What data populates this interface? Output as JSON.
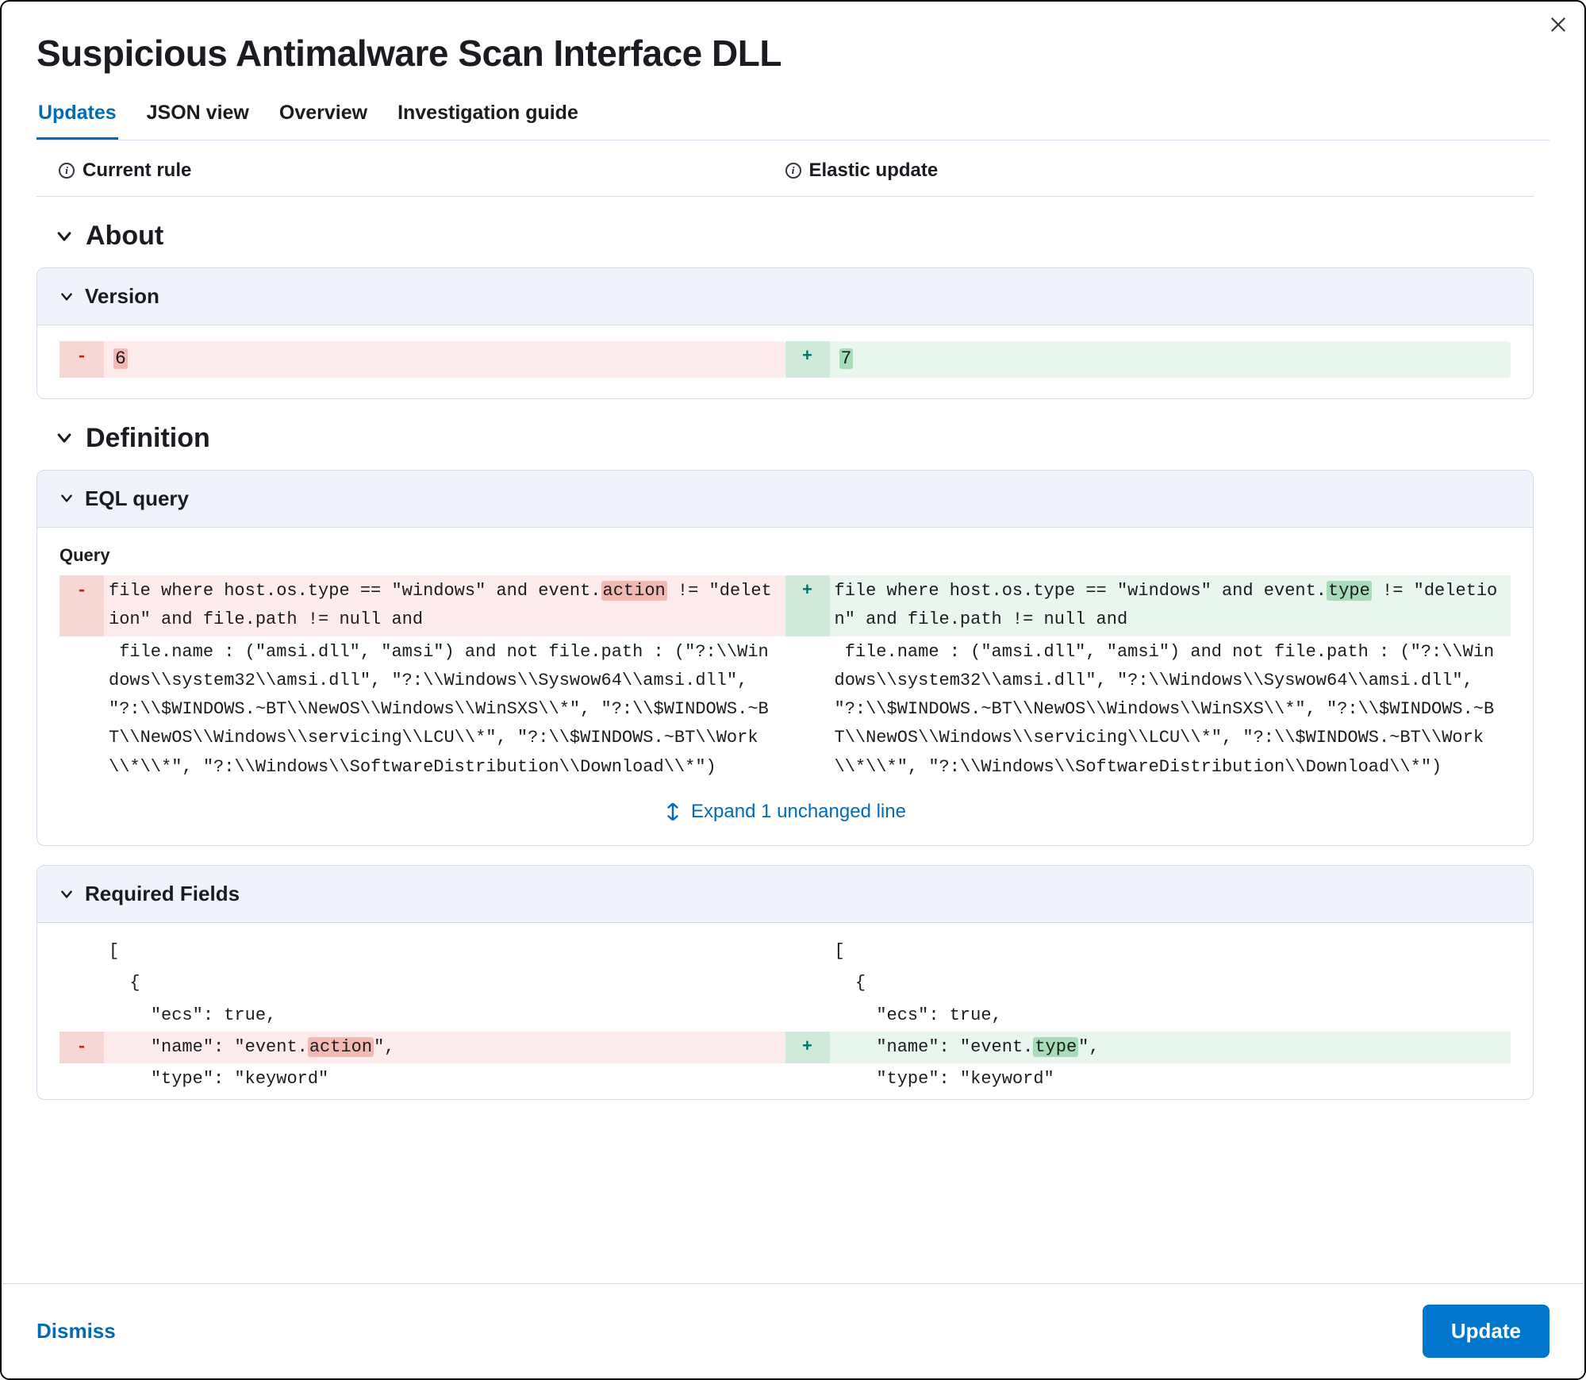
{
  "title": "Suspicious Antimalware Scan Interface DLL",
  "tabs": {
    "updates": "Updates",
    "json_view": "JSON view",
    "overview": "Overview",
    "investigation_guide": "Investigation guide"
  },
  "columns": {
    "current": "Current rule",
    "elastic": "Elastic update"
  },
  "sections": {
    "about": "About",
    "definition": "Definition"
  },
  "cards": {
    "version": "Version",
    "eql_query": "EQL query",
    "required_fields": "Required Fields"
  },
  "labels": {
    "query": "Query"
  },
  "version_diff": {
    "old": "6",
    "new": "7"
  },
  "query_diff": {
    "old_hl_pre": "file where host.os.type == \"windows\" and event.",
    "old_hl_token": "action",
    "old_hl_post": " != \"deletion\" and file.path != null and",
    "common": " file.name : (\"amsi.dll\", \"amsi\") and not file.path : (\"?:\\\\Windows\\\\system32\\\\amsi.dll\", \"?:\\\\Windows\\\\Syswow64\\\\amsi.dll\", \"?:\\\\$WINDOWS.~BT\\\\NewOS\\\\Windows\\\\WinSXS\\\\*\", \"?:\\\\$WINDOWS.~BT\\\\NewOS\\\\Windows\\\\servicing\\\\LCU\\\\*\", \"?:\\\\$WINDOWS.~BT\\\\Work\\\\*\\\\*\", \"?:\\\\Windows\\\\SoftwareDistribution\\\\Download\\\\*\")",
    "new_hl_pre": "file where host.os.type == \"windows\" and event.",
    "new_hl_token": "type",
    "new_hl_post": " != \"deletion\" and file.path != null and"
  },
  "expand_label": "Expand 1 unchanged line",
  "required_fields_diff": {
    "line1": "[",
    "line2": "  {",
    "line3": "    \"ecs\": true,",
    "old_name_pre": "    \"name\": \"event.",
    "old_name_hl": "action",
    "old_name_post": "\",",
    "new_name_pre": "    \"name\": \"event.",
    "new_name_hl": "type",
    "new_name_post": "\",",
    "line5": "    \"type\": \"keyword\""
  },
  "footer": {
    "dismiss": "Dismiss",
    "update": "Update"
  }
}
